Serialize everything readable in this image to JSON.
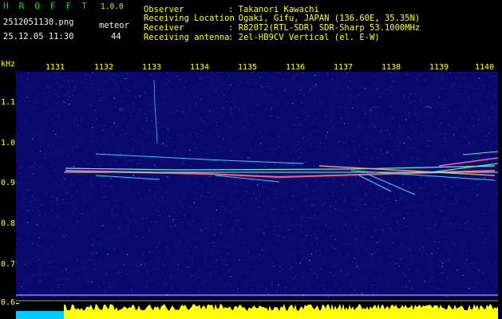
{
  "header": {
    "app_name": "H R O F F T",
    "version": "1.0.0",
    "filename": "2512051130.png",
    "category": "meteor",
    "datetime": "25.12.05 11:30",
    "count": "44",
    "info": [
      {
        "label": "Observer",
        "value": ": Takanori Kawachi"
      },
      {
        "label": "Receiving Location",
        "value": ": Ogaki, Gifu, JAPAN (136.60E, 35.35N)"
      },
      {
        "label": "Receiver",
        "value": ": R820T2(RTL-SDR) SDR-Sharp 53.1000MHz"
      },
      {
        "label": "Receiving antenna",
        "value": ": 2el-HB9CV Vertical (el. E-W)"
      }
    ]
  },
  "time_axis": {
    "labels": [
      "1131",
      "1132",
      "1133",
      "1134",
      "1135",
      "1136",
      "1137",
      "1138",
      "1139",
      "1140"
    ]
  },
  "freq_axis": {
    "unit": "kHz",
    "labels": [
      "1.1",
      "1.0",
      "0.9",
      "0.8",
      "0.7",
      "0.6"
    ]
  },
  "colors": {
    "background": "#0a0a6e",
    "text_yellow": "#ffff00",
    "text_white": "#f2f2f2",
    "app_green": "#00e000",
    "signal_trace": "#ffff00",
    "baseline": "#00ccff"
  }
}
